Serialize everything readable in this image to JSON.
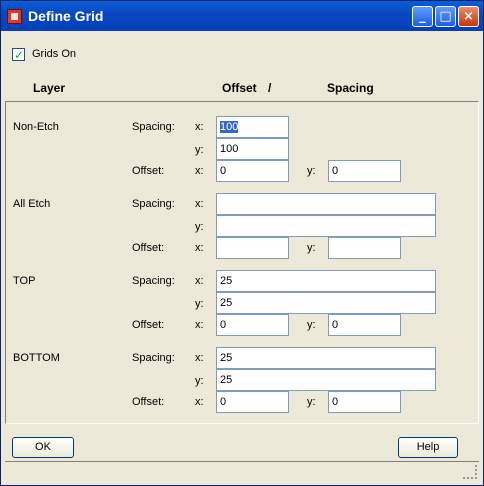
{
  "window": {
    "title": "Define Grid"
  },
  "grids_on": {
    "label": "Grids On",
    "checked": true
  },
  "headers": {
    "layer": "Layer",
    "offset": "Offset",
    "slash": "/",
    "spacing": "Spacing"
  },
  "labels": {
    "spacing": "Spacing:",
    "offset": "Offset:",
    "x": "x:",
    "y": "y:"
  },
  "layers": [
    {
      "name": "Non-Etch",
      "spacing_x": "100",
      "spacing_y": "100",
      "offset_x": "0",
      "offset_y": "0"
    },
    {
      "name": "All Etch",
      "spacing_x": "",
      "spacing_y": "",
      "offset_x": "",
      "offset_y": ""
    },
    {
      "name": "TOP",
      "spacing_x": "25",
      "spacing_y": "25",
      "offset_x": "0",
      "offset_y": "0"
    },
    {
      "name": "BOTTOM",
      "spacing_x": "25",
      "spacing_y": "25",
      "offset_x": "0",
      "offset_y": "0"
    }
  ],
  "buttons": {
    "ok": "OK",
    "help": "Help"
  }
}
